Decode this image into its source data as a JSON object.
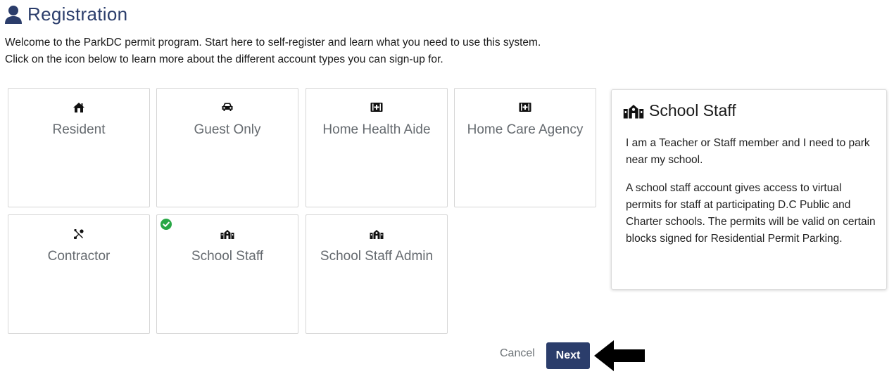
{
  "header": {
    "title": "Registration",
    "icon": "user-icon"
  },
  "intro": {
    "line1": "Welcome to the ParkDC permit program. Start here to self-register and learn what you need to use this system.",
    "line2": "Click on the icon below to learn more about the different account types you can sign-up for."
  },
  "account_types": [
    {
      "label": "Resident",
      "icon": "home-icon",
      "selected": false
    },
    {
      "label": "Guest Only",
      "icon": "car-icon",
      "selected": false
    },
    {
      "label": "Home Health Aide",
      "icon": "medkit-icon",
      "selected": false
    },
    {
      "label": "Home Care Agency",
      "icon": "medkit-icon",
      "selected": false
    },
    {
      "label": "Contractor",
      "icon": "tools-icon",
      "selected": false
    },
    {
      "label": "School Staff",
      "icon": "school-icon",
      "selected": true
    },
    {
      "label": "School Staff Admin",
      "icon": "school-icon",
      "selected": false
    }
  ],
  "panel": {
    "title": "School Staff",
    "icon": "school-icon",
    "paragraph1": "I am a Teacher or Staff member and I need to park near my school.",
    "paragraph2": "A school staff account gives access to virtual permits for staff at participating D.C Public and Charter schools. The permits will be valid on certain blocks signed for Residential Permit Parking."
  },
  "actions": {
    "cancel_label": "Cancel",
    "next_label": "Next"
  },
  "colors": {
    "primary": "#2b3d6b",
    "check": "#28a745",
    "muted_text": "#666b70"
  }
}
